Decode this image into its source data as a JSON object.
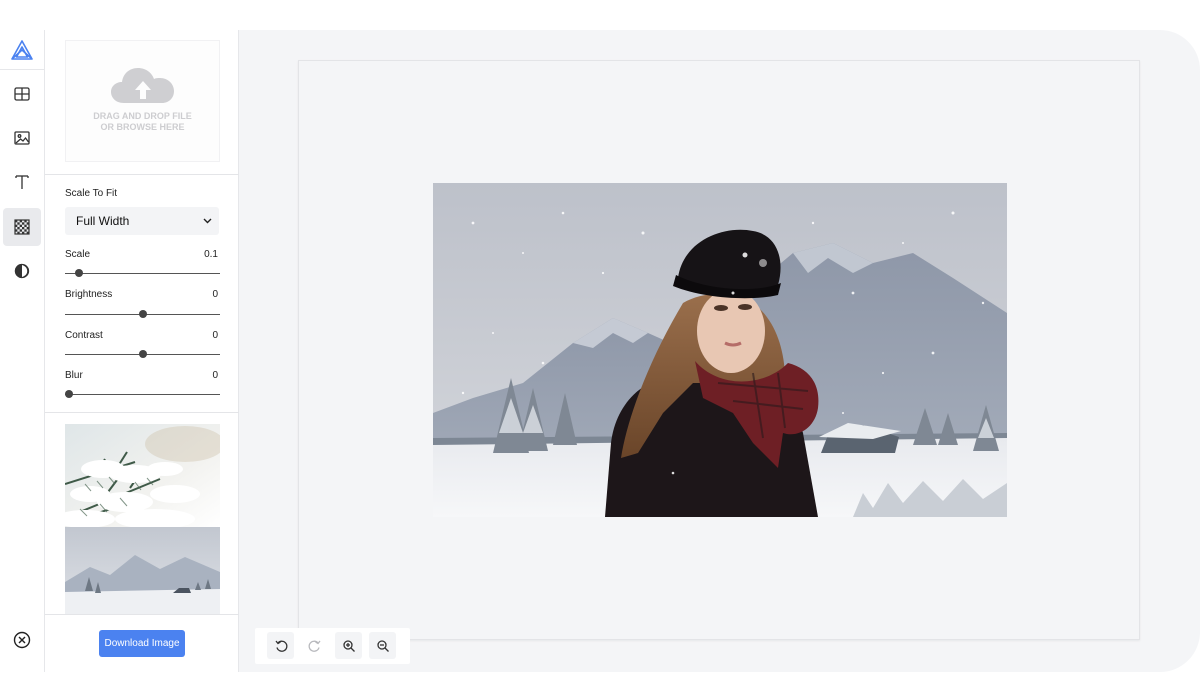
{
  "rail": {
    "items": [
      {
        "name": "logo",
        "icon": "app-logo-icon"
      },
      {
        "name": "layout",
        "icon": "grid-layout-icon"
      },
      {
        "name": "image",
        "icon": "image-icon"
      },
      {
        "name": "text",
        "icon": "text-icon"
      },
      {
        "name": "background",
        "icon": "checkerboard-icon",
        "active": true
      },
      {
        "name": "filters",
        "icon": "contrast-icon"
      },
      {
        "name": "close",
        "icon": "close-circle-icon"
      }
    ]
  },
  "upload": {
    "text": "DRAG AND DROP FILE OR BROWSE HERE",
    "icon": "cloud-upload-icon"
  },
  "scale_to_fit": {
    "label": "Scale To Fit",
    "selected": "Full Width"
  },
  "controls": [
    {
      "label": "Scale",
      "value": "0.1",
      "fraction": 0.07
    },
    {
      "label": "Brightness",
      "value": "0",
      "fraction": 0.5
    },
    {
      "label": "Contrast",
      "value": "0",
      "fraction": 0.5
    },
    {
      "label": "Blur",
      "value": "0",
      "fraction": 0.0
    }
  ],
  "gallery": {
    "items": [
      {
        "name": "snowy-pine-branch"
      },
      {
        "name": "snowy-mountain-valley"
      }
    ]
  },
  "download": {
    "label": "Download Image"
  },
  "toolbar": {
    "buttons": [
      {
        "name": "undo",
        "icon": "undo-icon",
        "enabled": true
      },
      {
        "name": "redo",
        "icon": "redo-icon",
        "enabled": false
      },
      {
        "name": "zoom-in",
        "icon": "zoom-in-icon",
        "enabled": true
      },
      {
        "name": "zoom-out",
        "icon": "zoom-out-icon",
        "enabled": true
      }
    ]
  },
  "colors": {
    "accent": "#4b82f0",
    "logo": "#4b82f0",
    "canvas_bg": "#f4f5f7"
  }
}
